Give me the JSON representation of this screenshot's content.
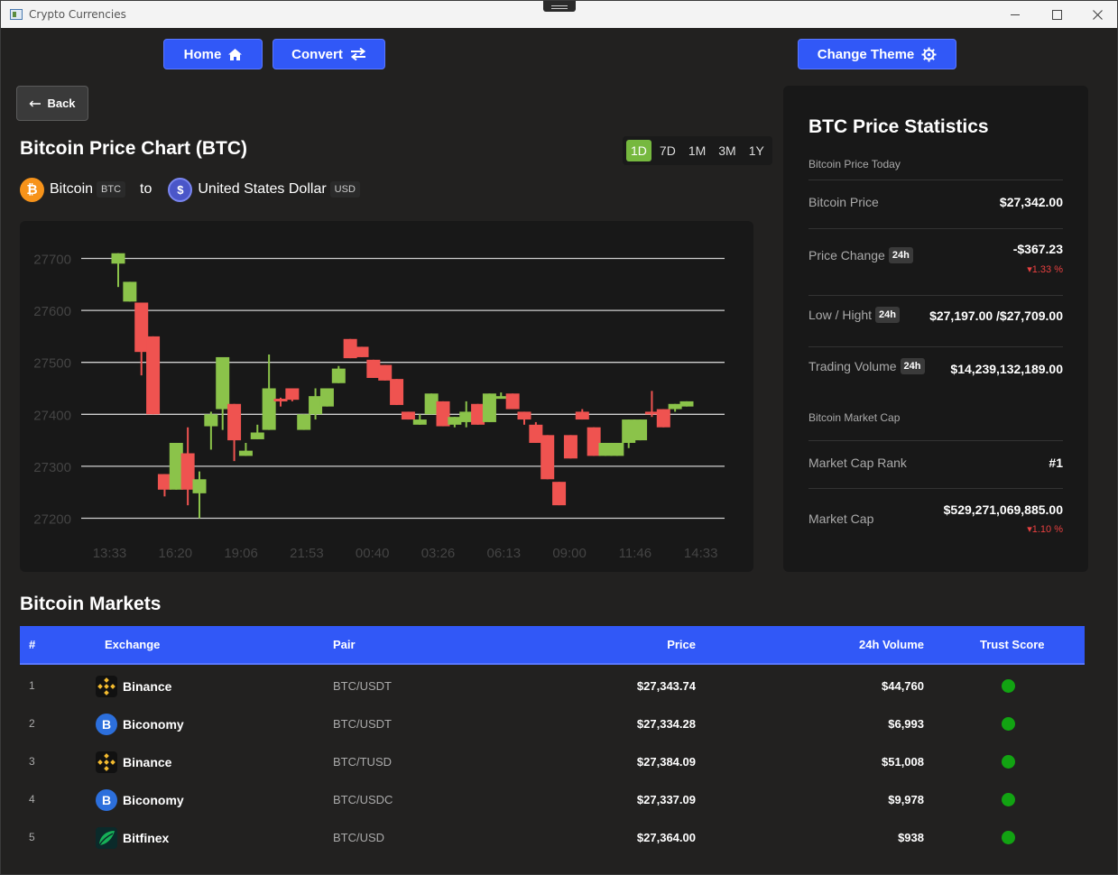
{
  "window": {
    "title": "Crypto Currencies"
  },
  "nav": {
    "home_label": "Home",
    "convert_label": "Convert",
    "theme_label": "Change Theme"
  },
  "back_label": "Back",
  "chart_header": {
    "title": "Bitcoin Price Chart (BTC)",
    "periods": [
      "1D",
      "7D",
      "1M",
      "3M",
      "1Y"
    ],
    "active_period": "1D"
  },
  "pair": {
    "from_name": "Bitcoin",
    "from_symbol": "BTC",
    "connector": "to",
    "to_name": "United States Dollar",
    "to_symbol": "USD"
  },
  "chart_data": {
    "type": "candlestick",
    "y_ticks": [
      27700,
      27600,
      27500,
      27400,
      27300,
      27200
    ],
    "x_ticks": [
      "13:33",
      "16:20",
      "19:06",
      "21:53",
      "00:40",
      "03:26",
      "06:13",
      "09:00",
      "11:46",
      "14:33"
    ],
    "ylim": [
      27160,
      27730
    ],
    "up_color": "#8bc34a",
    "down_color": "#ef5350",
    "candles": [
      {
        "o": 27690,
        "c": 27710,
        "h": 27710,
        "l": 27645
      },
      {
        "o": 27617,
        "c": 27655,
        "h": 27655,
        "l": 27617
      },
      {
        "o": 27615,
        "c": 27520,
        "h": 27615,
        "l": 27475
      },
      {
        "o": 27550,
        "c": 27400,
        "h": 27550,
        "l": 27400
      },
      {
        "o": 27285,
        "c": 27255,
        "h": 27285,
        "l": 27242
      },
      {
        "o": 27255,
        "c": 27345,
        "h": 27345,
        "l": 27255
      },
      {
        "o": 27325,
        "c": 27255,
        "h": 27375,
        "l": 27225
      },
      {
        "o": 27248,
        "c": 27275,
        "h": 27290,
        "l": 27200
      },
      {
        "o": 27377,
        "c": 27400,
        "h": 27405,
        "l": 27332
      },
      {
        "o": 27410,
        "c": 27510,
        "h": 27510,
        "l": 27370
      },
      {
        "o": 27420,
        "c": 27350,
        "h": 27420,
        "l": 27310
      },
      {
        "o": 27320,
        "c": 27330,
        "h": 27345,
        "l": 27320
      },
      {
        "o": 27352,
        "c": 27365,
        "h": 27380,
        "l": 27352
      },
      {
        "o": 27370,
        "c": 27450,
        "h": 27515,
        "l": 27370
      },
      {
        "o": 27430,
        "c": 27425,
        "h": 27432,
        "l": 27415
      },
      {
        "o": 27450,
        "c": 27428,
        "h": 27450,
        "l": 27425
      },
      {
        "o": 27370,
        "c": 27400,
        "h": 27400,
        "l": 27370
      },
      {
        "o": 27400,
        "c": 27435,
        "h": 27450,
        "l": 27390
      },
      {
        "o": 27415,
        "c": 27450,
        "h": 27450,
        "l": 27415
      },
      {
        "o": 27460,
        "c": 27488,
        "h": 27493,
        "l": 27460
      },
      {
        "o": 27545,
        "c": 27508,
        "h": 27545,
        "l": 27508
      },
      {
        "o": 27530,
        "c": 27510,
        "h": 27530,
        "l": 27510
      },
      {
        "o": 27505,
        "c": 27470,
        "h": 27505,
        "l": 27470
      },
      {
        "o": 27495,
        "c": 27465,
        "h": 27495,
        "l": 27465
      },
      {
        "o": 27468,
        "c": 27418,
        "h": 27468,
        "l": 27418
      },
      {
        "o": 27405,
        "c": 27390,
        "h": 27405,
        "l": 27390
      },
      {
        "o": 27380,
        "c": 27390,
        "h": 27400,
        "l": 27380
      },
      {
        "o": 27400,
        "c": 27440,
        "h": 27440,
        "l": 27400
      },
      {
        "o": 27425,
        "c": 27377,
        "h": 27425,
        "l": 27377
      },
      {
        "o": 27380,
        "c": 27395,
        "h": 27395,
        "l": 27375
      },
      {
        "o": 27385,
        "c": 27405,
        "h": 27425,
        "l": 27375
      },
      {
        "o": 27420,
        "c": 27380,
        "h": 27420,
        "l": 27380
      },
      {
        "o": 27385,
        "c": 27440,
        "h": 27440,
        "l": 27385
      },
      {
        "o": 27430,
        "c": 27435,
        "h": 27442,
        "l": 27430
      },
      {
        "o": 27440,
        "c": 27410,
        "h": 27440,
        "l": 27410
      },
      {
        "o": 27405,
        "c": 27390,
        "h": 27405,
        "l": 27380
      },
      {
        "o": 27380,
        "c": 27345,
        "h": 27385,
        "l": 27345
      },
      {
        "o": 27360,
        "c": 27275,
        "h": 27360,
        "l": 27275
      },
      {
        "o": 27270,
        "c": 27225,
        "h": 27270,
        "l": 27225
      },
      {
        "o": 27360,
        "c": 27315,
        "h": 27360,
        "l": 27315
      },
      {
        "o": 27405,
        "c": 27390,
        "h": 27410,
        "l": 27390
      },
      {
        "o": 27375,
        "c": 27320,
        "h": 27375,
        "l": 27320
      },
      {
        "o": 27320,
        "c": 27345,
        "h": 27345,
        "l": 27320
      },
      {
        "o": 27320,
        "c": 27345,
        "h": 27345,
        "l": 27320
      },
      {
        "o": 27345,
        "c": 27390,
        "h": 27390,
        "l": 27335
      },
      {
        "o": 27350,
        "c": 27390,
        "h": 27390,
        "l": 27350
      },
      {
        "o": 27405,
        "c": 27400,
        "h": 27445,
        "l": 27395
      },
      {
        "o": 27410,
        "c": 27375,
        "h": 27410,
        "l": 27375
      },
      {
        "o": 27410,
        "c": 27420,
        "h": 27420,
        "l": 27405
      },
      {
        "o": 27415,
        "c": 27425,
        "h": 27425,
        "l": 27415
      }
    ]
  },
  "stats": {
    "title": "BTC Price Statistics",
    "subtitle": "Bitcoin Price Today",
    "bitcoin_price_label": "Bitcoin Price",
    "bitcoin_price": "$27,342.00",
    "price_change_label": "Price Change",
    "price_change": "-$367.23",
    "price_change_pct": "1.33 %",
    "low_high_label": "Low / Hight",
    "low_high": "$27,197.00 /$27,709.00",
    "volume_label": "Trading Volume",
    "volume": "$14,239,132,189.00",
    "market_cap_section": "Bitcoin Market Cap",
    "rank_label": "Market Cap Rank",
    "rank": "#1",
    "market_cap_label": "Market Cap",
    "market_cap": "$529,271,069,885.00",
    "market_cap_pct": "1.10 %",
    "tag": "24h"
  },
  "markets": {
    "title": "Bitcoin Markets",
    "headers": {
      "idx": "#",
      "exchange": "Exchange",
      "pair": "Pair",
      "price": "Price",
      "volume": "24h Volume",
      "trust": "Trust Score"
    },
    "rows": [
      {
        "idx": "1",
        "exchange": "Binance",
        "icon": "binance-icon",
        "pair": "BTC/USDT",
        "price": "$27,343.74",
        "volume": "$44,760"
      },
      {
        "idx": "2",
        "exchange": "Biconomy",
        "icon": "biconomy-icon",
        "pair": "BTC/USDT",
        "price": "$27,334.28",
        "volume": "$6,993"
      },
      {
        "idx": "3",
        "exchange": "Binance",
        "icon": "binance-icon",
        "pair": "BTC/TUSD",
        "price": "$27,384.09",
        "volume": "$51,008"
      },
      {
        "idx": "4",
        "exchange": "Biconomy",
        "icon": "biconomy-icon",
        "pair": "BTC/USDC",
        "price": "$27,337.09",
        "volume": "$9,978"
      },
      {
        "idx": "5",
        "exchange": "Bitfinex",
        "icon": "bitfinex-icon",
        "pair": "BTC/USD",
        "price": "$27,364.00",
        "volume": "$938"
      }
    ],
    "trust_color": "#12a312"
  }
}
